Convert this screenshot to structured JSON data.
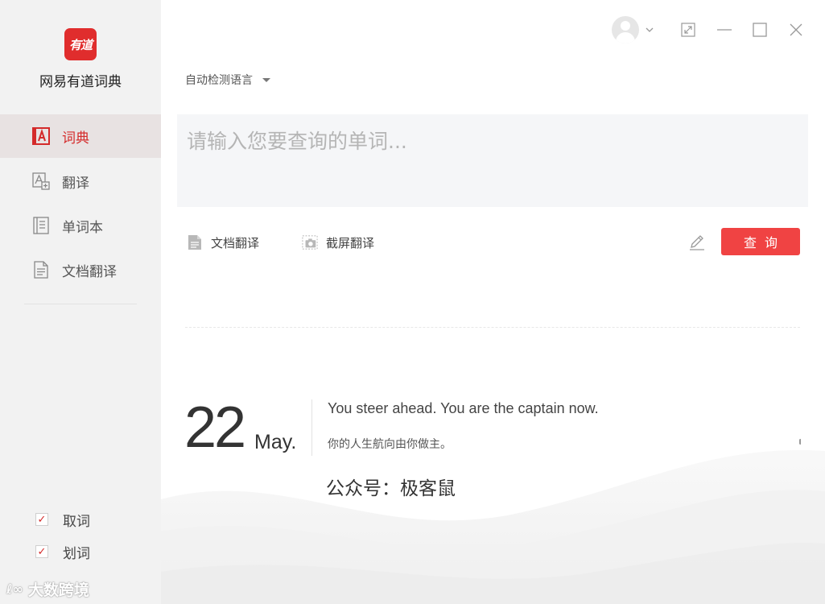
{
  "app": {
    "logo_text": "有道",
    "title": "网易有道词典"
  },
  "sidebar": {
    "items": [
      {
        "label": "词典",
        "icon": "dictionary-icon",
        "active": true
      },
      {
        "label": "翻译",
        "icon": "translate-icon",
        "active": false
      },
      {
        "label": "单词本",
        "icon": "wordbook-icon",
        "active": false
      },
      {
        "label": "文档翻译",
        "icon": "document-icon",
        "active": false
      }
    ],
    "checks": [
      {
        "label": "取词",
        "checked": true
      },
      {
        "label": "划词",
        "checked": true
      }
    ],
    "watermark": "大数跨境",
    "watermark_logo": "ℓ∞"
  },
  "search": {
    "language": "自动检测语言",
    "placeholder": "请输入您要查询的单词...",
    "value": ""
  },
  "tools": {
    "doc_translate": "文档翻译",
    "screenshot_translate": "截屏翻译",
    "query_button": "查询"
  },
  "daily": {
    "day": "22",
    "month": "May.",
    "sentence_en": "You steer ahead. You are the captain now.",
    "sentence_zh": "你的人生航向由你做主。",
    "account": "公众号：极客鼠"
  },
  "colors": {
    "accent": "#f04343",
    "active_text": "#d42a2a",
    "sidebar_bg": "#f2f2f2",
    "search_bg": "#f5f6f8"
  }
}
